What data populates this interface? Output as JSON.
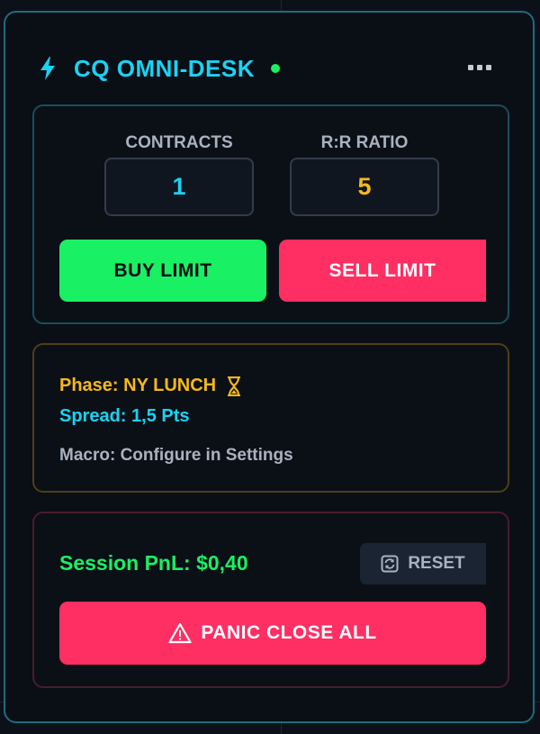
{
  "header": {
    "title": "CQ OMNI-DESK",
    "icon": "bolt-icon",
    "status_color": "#19f063",
    "menu_icon": "more-horizontal-icon"
  },
  "order": {
    "contracts_label": "CONTRACTS",
    "contracts_value": "1",
    "rr_label": "R:R RATIO",
    "rr_value": "5",
    "buy_label": "BUY LIMIT",
    "sell_label": "SELL LIMIT"
  },
  "info": {
    "phase": "Phase: NY LUNCH",
    "phase_icon": "hourglass-icon",
    "spread": "Spread: 1,5 Pts",
    "macro": "Macro: Configure in Settings"
  },
  "pnl": {
    "session_pnl": "Session PnL: $0,40",
    "reset_label": "RESET",
    "reset_icon": "refresh-icon",
    "panic_label": "PANIC CLOSE ALL",
    "panic_icon": "warning-icon"
  },
  "colors": {
    "accent_cyan": "#19d3f3",
    "buy_green": "#19f063",
    "sell_red": "#ff2e63",
    "warning_amber": "#f7b91b"
  }
}
